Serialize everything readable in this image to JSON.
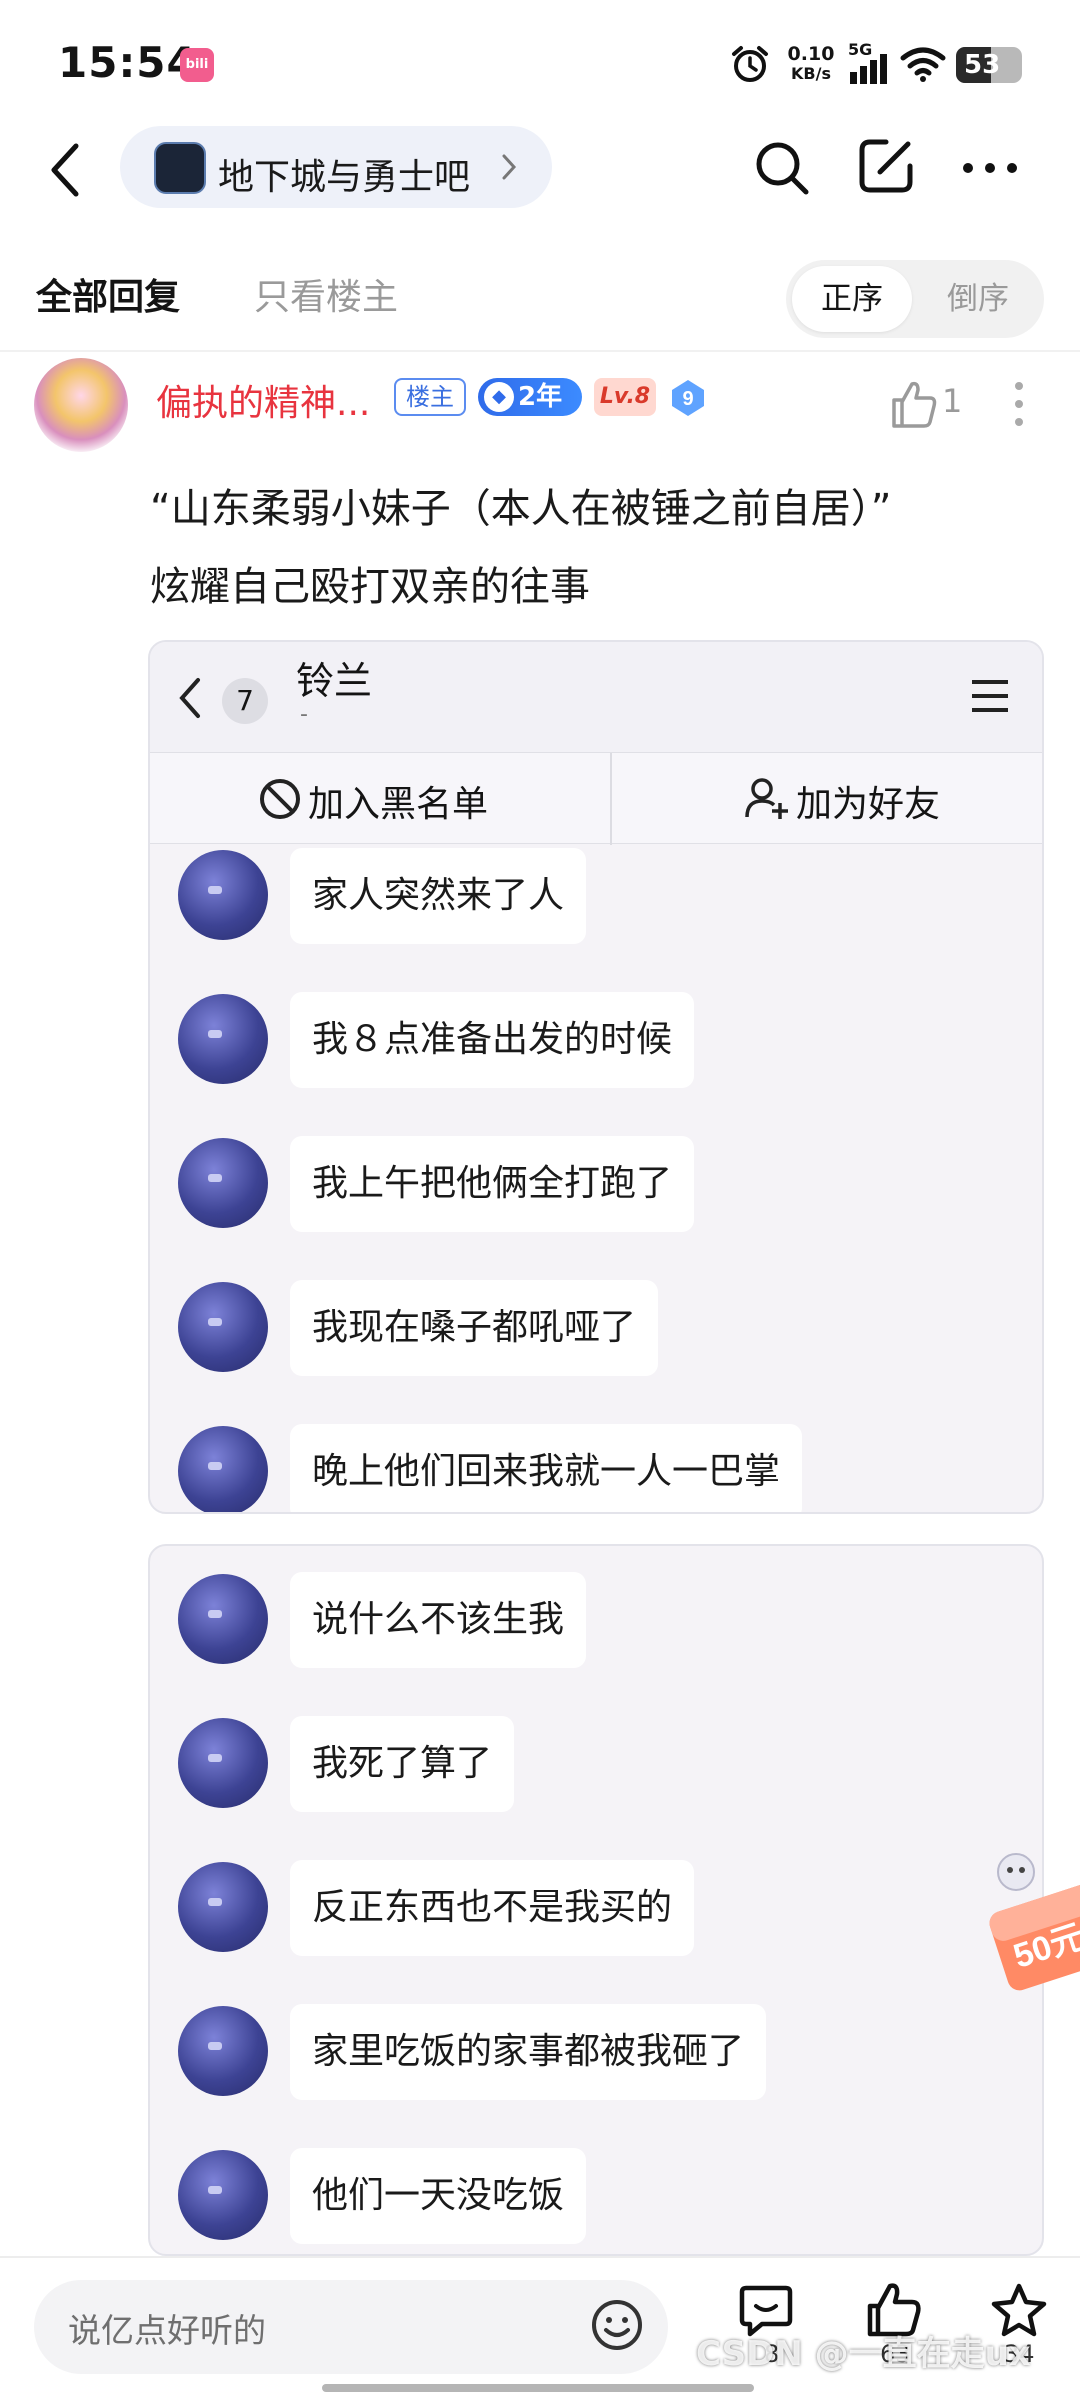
{
  "status_bar": {
    "time": "15:54",
    "net_speed_value": "0.10",
    "net_speed_unit": "KB/s",
    "signal_label": "5G",
    "battery": "53",
    "battery_level": 0.53
  },
  "nav": {
    "forum_name": "地下城与勇士吧"
  },
  "tabs": {
    "all": "全部回复",
    "op_only": "只看楼主",
    "sort_asc": "正序",
    "sort_desc": "倒序"
  },
  "post": {
    "username": "偏执的精神...",
    "op_badge": "楼主",
    "age_badge": "2年",
    "level_badge": "Lv.8",
    "vip_level": "9",
    "like_count": "1",
    "text_line1": "“山东柔弱小妹子（本人在被锤之前自居）”",
    "text_line2": "炫耀自己殴打双亲的往事"
  },
  "screenshot1": {
    "unread_count": "7",
    "contact_name": "铃兰",
    "contact_sub": "-",
    "block_label": "加入黑名单",
    "add_friend_label": "加为好友",
    "messages": [
      "家人突然来了人",
      "我８点准备出发的时候",
      "我上午把他俩全打跑了",
      "我现在嗓子都吼哑了",
      "晚上他们回来我就一人一巴掌"
    ]
  },
  "screenshot2": {
    "messages": [
      "说什么不该生我",
      "我死了算了",
      "反正东西也不是我买的",
      "家里吃饭的家事都被我砸了",
      "他们一天没吃饭"
    ]
  },
  "promo": {
    "label": "50元"
  },
  "bottom_bar": {
    "reply_placeholder": "说亿点好听的",
    "comment_count": "8",
    "like_count": "63",
    "star_count": "34",
    "watermark": "CSDN @一直在走ux"
  }
}
